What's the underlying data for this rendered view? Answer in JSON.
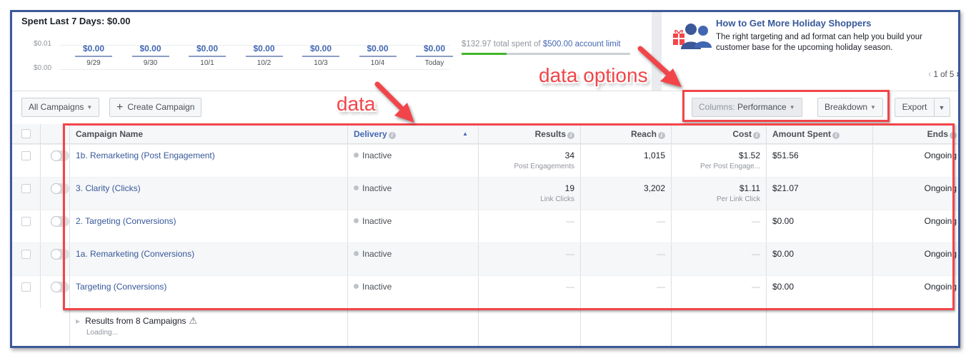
{
  "spend_summary": {
    "title": "Spent Last 7 Days: $0.00",
    "y_ticks": [
      "$0.01",
      "$0.00"
    ],
    "chart_data": {
      "type": "bar",
      "title": "Spent Last 7 Days: $0.00",
      "categories": [
        "9/29",
        "9/30",
        "10/1",
        "10/2",
        "10/3",
        "10/4",
        "Today"
      ],
      "values": [
        0.0,
        0.0,
        0.0,
        0.0,
        0.0,
        0.0,
        0.0
      ],
      "value_labels": [
        "$0.00",
        "$0.00",
        "$0.00",
        "$0.00",
        "$0.00",
        "$0.00",
        "$0.00"
      ],
      "ylim": [
        0,
        0.01
      ],
      "ytick_labels": [
        "$0.01",
        "$0.00"
      ],
      "xlabel": "",
      "ylabel": ""
    },
    "account_limit": {
      "spent_text": "$132.97 total spent of ",
      "limit_link": "$500.00 account limit",
      "spent_value": 132.97,
      "limit_value": 500.0,
      "progress_fraction": 0.266,
      "progress_color": "#42b72a"
    }
  },
  "promo": {
    "icon": "gift-people-icon",
    "title": "How to Get More Holiday Shoppers",
    "body": "The right targeting and ad format can help you build your customer base for the upcoming holiday season.",
    "pager": "1 of 5",
    "prev_icon": "chevron-left-icon",
    "next_icon": "chevron-right-icon"
  },
  "toolbar": {
    "all_campaigns": "All Campaigns",
    "create_campaign": "Create Campaign",
    "columns_prefix": "Columns: ",
    "columns_value": "Performance",
    "breakdown": "Breakdown",
    "export": "Export"
  },
  "table": {
    "headers": {
      "name": "Campaign Name",
      "delivery": "Delivery",
      "results": "Results",
      "reach": "Reach",
      "cost": "Cost",
      "amount_spent": "Amount Spent",
      "ends": "Ends"
    },
    "sorted_column": "delivery",
    "rows": [
      {
        "name": "1b. Remarketing (Post Engagement)",
        "delivery": "Inactive",
        "results": "34",
        "results_sub": "Post Engagements",
        "reach": "1,015",
        "cost": "$1.52",
        "cost_sub": "Per Post Engage...",
        "amount_spent": "$51.56",
        "ends": "Ongoing"
      },
      {
        "name": "3. Clarity (Clicks)",
        "delivery": "Inactive",
        "results": "19",
        "results_sub": "Link Clicks",
        "reach": "3,202",
        "cost": "$1.11",
        "cost_sub": "Per Link Click",
        "amount_spent": "$21.07",
        "ends": "Ongoing"
      },
      {
        "name": "2. Targeting (Conversions)",
        "delivery": "Inactive",
        "results": "—",
        "results_sub": "",
        "reach": "—",
        "cost": "—",
        "cost_sub": "",
        "amount_spent": "$0.00",
        "ends": "Ongoing"
      },
      {
        "name": "1a. Remarketing (Conversions)",
        "delivery": "Inactive",
        "results": "—",
        "results_sub": "",
        "reach": "—",
        "cost": "—",
        "cost_sub": "",
        "amount_spent": "$0.00",
        "ends": "Ongoing"
      },
      {
        "name": "Targeting (Conversions)",
        "delivery": "Inactive",
        "results": "—",
        "results_sub": "",
        "reach": "—",
        "cost": "—",
        "cost_sub": "",
        "amount_spent": "$0.00",
        "ends": "Ongoing"
      }
    ],
    "summary": {
      "title": "Results from 8 Campaigns",
      "status": "Loading..."
    }
  },
  "annotations": {
    "data_label": "data",
    "options_label": "data options",
    "color": "#f2454a"
  },
  "colors": {
    "frame_border": "#3b5998",
    "link": "#365899",
    "accent": "#4267b2"
  }
}
